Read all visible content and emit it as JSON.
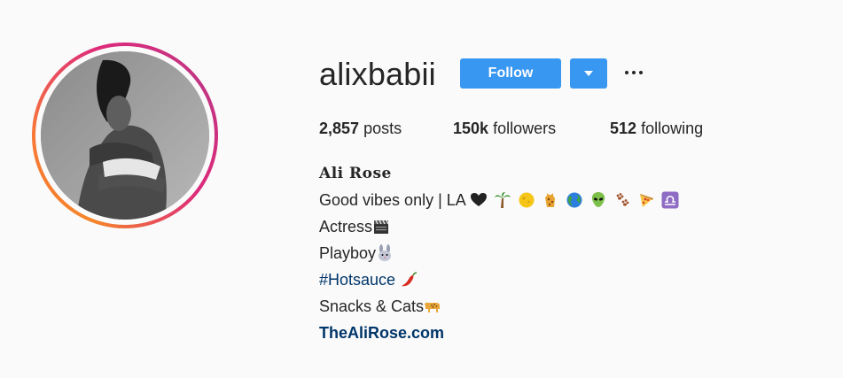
{
  "profile": {
    "username": "alixbabii",
    "follow_label": "Follow",
    "full_name": "Ali Rose",
    "stats": {
      "posts_count": "2,857",
      "posts_label": "posts",
      "followers_count": "150k",
      "followers_label": "followers",
      "following_count": "512",
      "following_label": "following"
    },
    "bio": {
      "line1_text": "Good vibes only | LA ",
      "line2_text": "Actress",
      "line3_text": "Playboy",
      "line4_hashtag": "#Hotsauce",
      "line5_text": "Snacks & Cats",
      "website": "TheAliRose.com"
    }
  },
  "colors": {
    "primary_button": "#3897f0",
    "link": "#003569",
    "background": "#fafafa"
  },
  "icons": {
    "line1_emojis": [
      "black-heart-icon",
      "palm-tree-icon",
      "full-moon-icon",
      "giraffe-icon",
      "globe-icon",
      "alien-icon",
      "paw-prints-icon",
      "pizza-icon",
      "libra-icon"
    ],
    "line2_emoji": "clapper-board-icon",
    "line3_emoji": "rabbit-face-icon",
    "line4_emoji": "hot-pepper-icon",
    "line5_emoji": "leopard-icon",
    "more_options": "more-options-icon",
    "dropdown": "chevron-down-icon"
  }
}
